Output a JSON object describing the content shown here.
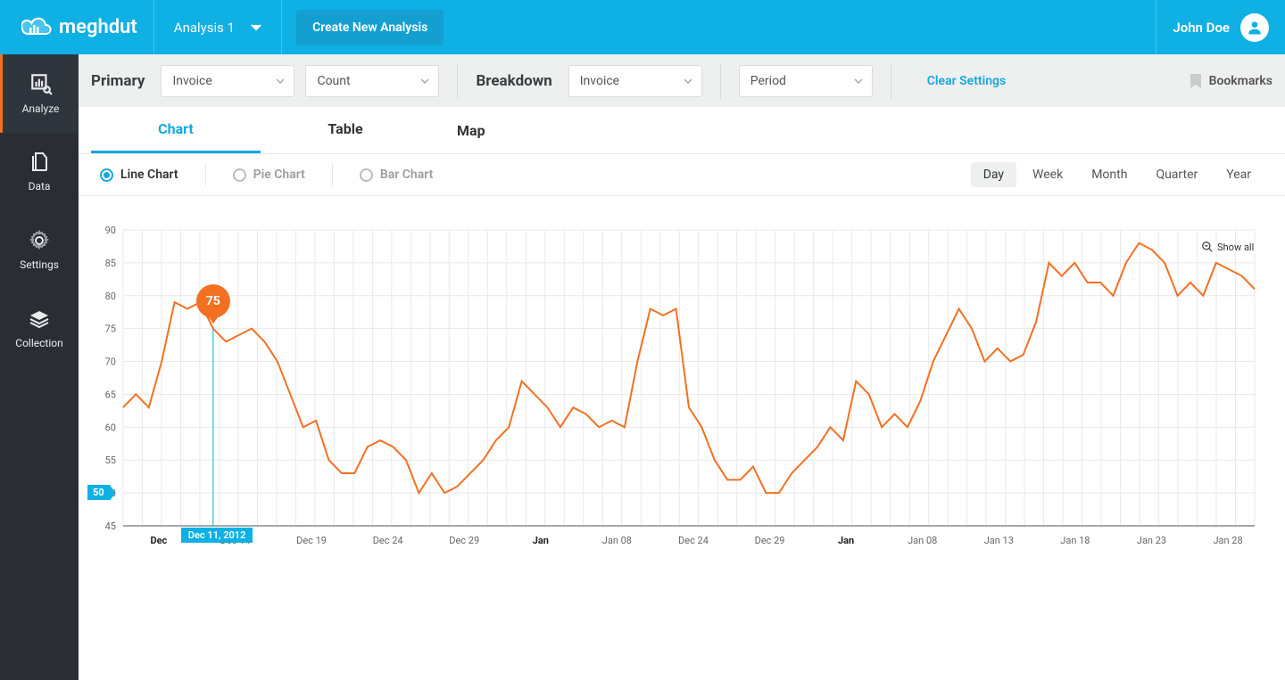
{
  "header": {
    "brand": "meghdut",
    "analysis_name": "Analysis 1",
    "new_analysis": "Create New Analysis",
    "user_name": "John Doe"
  },
  "sidebar": {
    "items": [
      {
        "label": "Analyze"
      },
      {
        "label": "Data"
      },
      {
        "label": "Settings"
      },
      {
        "label": "Collection"
      }
    ]
  },
  "filterbar": {
    "primary_label": "Primary",
    "primary_select1": "Invoice",
    "primary_select2": "Count",
    "breakdown_label": "Breakdown",
    "breakdown_select1": "Invoice",
    "breakdown_select2": "Period",
    "clear": "Clear Settings",
    "bookmarks": "Bookmarks"
  },
  "tabs": {
    "chart": "Chart",
    "table": "Table",
    "map": "Map"
  },
  "chart_types": {
    "line": "Line Chart",
    "pie": "Pie Chart",
    "bar": "Bar Chart"
  },
  "ranges": {
    "day": "Day",
    "week": "Week",
    "month": "Month",
    "quarter": "Quarter",
    "year": "Year"
  },
  "tooltip": {
    "value": "75",
    "date": "Dec 11, 2012",
    "hline": "50"
  },
  "showall": "Show all",
  "chart_data": {
    "type": "line",
    "ylim": [
      45,
      90
    ],
    "y_ticks": [
      45,
      50,
      55,
      60,
      65,
      70,
      75,
      80,
      85,
      90
    ],
    "x_ticks": [
      "Dec",
      "Dec 14",
      "Dec 19",
      "Dec 24",
      "Dec 29",
      "Jan",
      "Jan 08",
      "Dec 24",
      "Dec 29",
      "Jan",
      "Jan 08",
      "Jan 13",
      "Jan 18",
      "Jan 23",
      "Jan 28"
    ],
    "x_bold": [
      "Dec",
      "Jan",
      "Jan"
    ],
    "highlight": {
      "index": 7,
      "value": 75,
      "label": "Dec 11, 2012"
    },
    "hline": 50,
    "values": [
      63,
      65,
      63,
      70,
      79,
      78,
      79,
      75,
      73,
      74,
      75,
      73,
      70,
      65,
      60,
      61,
      55,
      53,
      53,
      57,
      58,
      57,
      55,
      50,
      53,
      50,
      51,
      53,
      55,
      58,
      60,
      67,
      65,
      63,
      60,
      63,
      62,
      60,
      61,
      60,
      70,
      78,
      77,
      78,
      63,
      60,
      55,
      52,
      52,
      54,
      50,
      50,
      53,
      55,
      57,
      60,
      58,
      67,
      65,
      60,
      62,
      60,
      64,
      70,
      74,
      78,
      75,
      70,
      72,
      70,
      71,
      76,
      85,
      83,
      85,
      82,
      82,
      80,
      85,
      88,
      87,
      85,
      80,
      82,
      80,
      85,
      84,
      83,
      81
    ]
  }
}
